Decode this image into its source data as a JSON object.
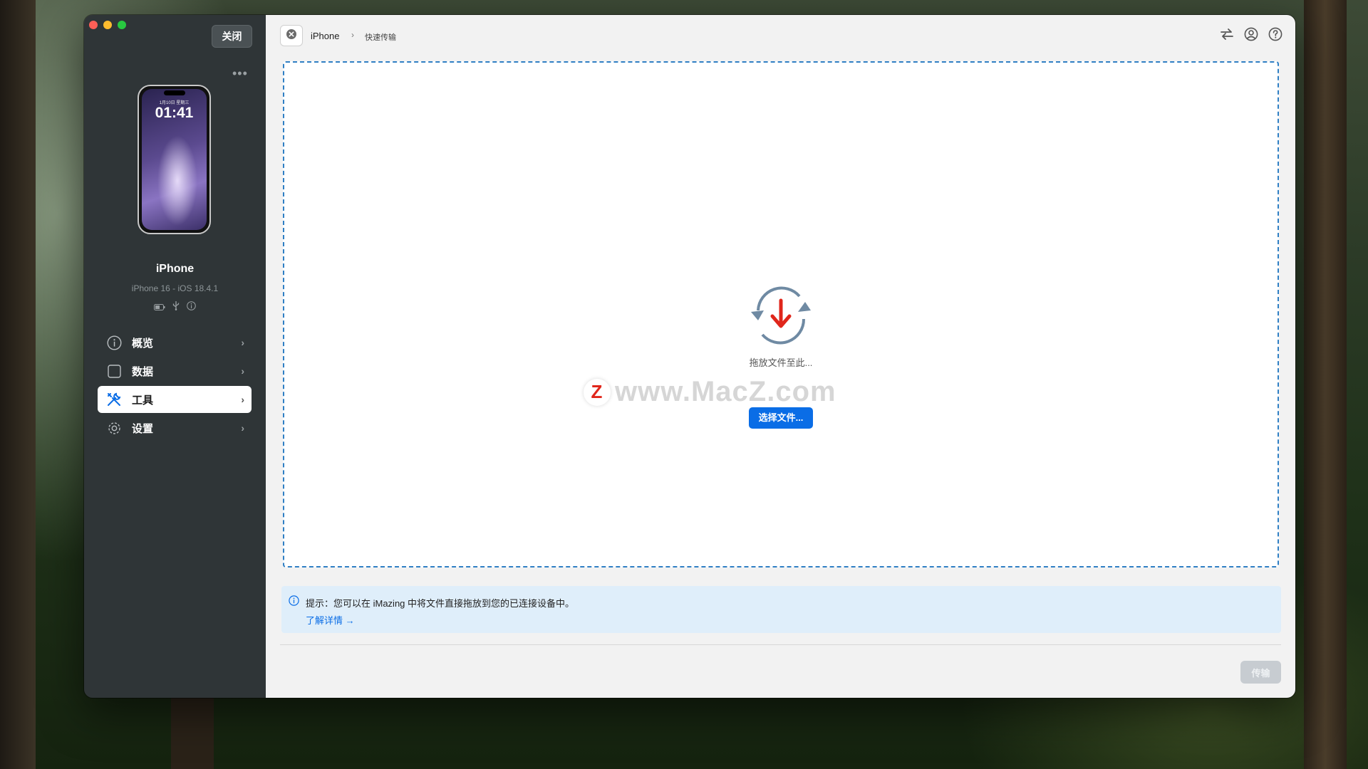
{
  "sidebar": {
    "close_label": "关闭",
    "more_icon": "ellipsis-icon",
    "device": {
      "lock_date": "1月10日 星期三",
      "lock_time": "01:41",
      "name": "iPhone",
      "model": "iPhone 16 - iOS 18.4.1"
    },
    "nav": [
      {
        "label": "概览",
        "icon": "info-icon"
      },
      {
        "label": "数据",
        "icon": "square-icon"
      },
      {
        "label": "工具",
        "icon": "tools-icon",
        "active": true
      },
      {
        "label": "设置",
        "icon": "gear-icon"
      }
    ]
  },
  "header": {
    "breadcrumb_root": "iPhone",
    "breadcrumb_sep": "›",
    "breadcrumb_current": "快速传输"
  },
  "drop": {
    "hint": "拖放文件至此...",
    "select_button": "选择文件..."
  },
  "watermark": {
    "logo": "Z",
    "text": "www.MacZ.com"
  },
  "tip": {
    "text": "提示：您可以在 iMazing 中将文件直接拖放到您的已连接设备中。",
    "link": "了解详情 →"
  },
  "footer": {
    "transfer_button": "传输"
  },
  "colors": {
    "accent": "#0a6de6",
    "sidebar_bg": "#2f3537",
    "drop_border": "#2f7fc4",
    "arrow_red": "#e0261b"
  }
}
